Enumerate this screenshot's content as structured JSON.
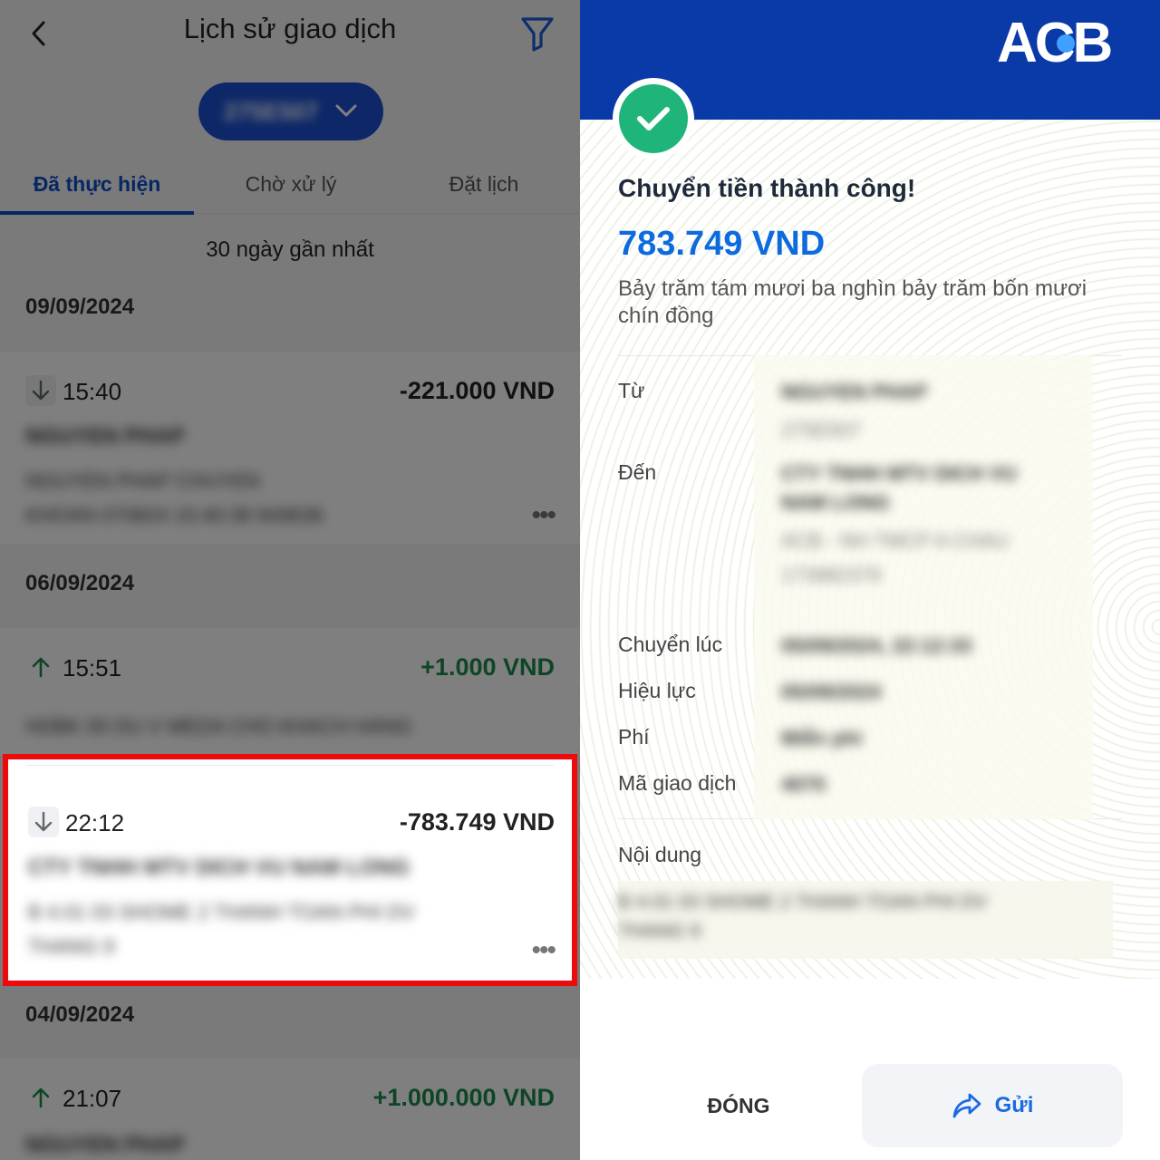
{
  "history": {
    "title": "Lịch sử giao dịch",
    "account_number": "275E507",
    "tabs": [
      {
        "label": "Đã thực hiện",
        "active": true
      },
      {
        "label": "Chờ xử lý",
        "active": false
      },
      {
        "label": "Đặt lịch",
        "active": false
      }
    ],
    "period_label": "30 ngày gần nhất",
    "groups": [
      {
        "date": "09/09/2024"
      },
      {
        "date": "06/09/2024"
      },
      {
        "date": "04/09/2024"
      }
    ],
    "transactions": [
      {
        "direction": "out",
        "time": "15:40",
        "amount": "-221.000 VND",
        "name": "NGUYEN PHAP",
        "desc1": "NGUYEN PHAP CHUYEN",
        "desc2": "KHOAN 070824 15:40:38 849636"
      },
      {
        "direction": "in",
        "time": "15:51",
        "amount": "+1.000 VND",
        "desc1": "HDBK 00 DU V MEDA CHO KHACH HANG"
      },
      {
        "direction": "out",
        "time": "22:12",
        "amount": "-783.749 VND",
        "name": "CTY TNHH MTV DICH VU NAM LONG",
        "desc1": "B 4.01 03 SHOME 2 THANH TOAN PHI DV",
        "desc2": "THANG 9"
      },
      {
        "direction": "in",
        "time": "21:07",
        "amount": "+1.000.000 VND",
        "name": "NGUYEN PHAP"
      }
    ]
  },
  "receipt": {
    "brand": "ACB",
    "success_title": "Chuyển tiền thành công!",
    "amount": "783.749 VND",
    "amount_words": "Bảy trăm tám mươi ba nghìn bảy trăm bốn mươi chín đồng",
    "labels": {
      "from": "Từ",
      "to": "Đến",
      "time": "Chuyển lúc",
      "effective": "Hiệu lực",
      "fee": "Phí",
      "code": "Mã giao dịch",
      "content": "Nội dung"
    },
    "values": {
      "from_name": "NGUYEN PHAP",
      "from_account": "275E507",
      "to_name_1": "CTY TNHH MTV DICH VU",
      "to_name_2": "NAM LONG",
      "to_bank": "ACB - NH TMCP A CHAU",
      "to_account": "173982379",
      "time": "05/09/2024, 22:12:33",
      "effective": "05/09/2024",
      "fee": "Miễn phí",
      "code": "4070",
      "content_1": "B 4.01 03 SHOME 2 THANH TOAN PHI DV",
      "content_2": "THANG 9"
    },
    "close_label": "ĐÓNG",
    "send_label": "Gửi"
  },
  "colors": {
    "brand_blue": "#0a3aa8",
    "accent_blue": "#0d6bde",
    "success_green": "#1fb57a",
    "positive": "#1d8a4a",
    "highlight_red": "#ee0a0a"
  }
}
